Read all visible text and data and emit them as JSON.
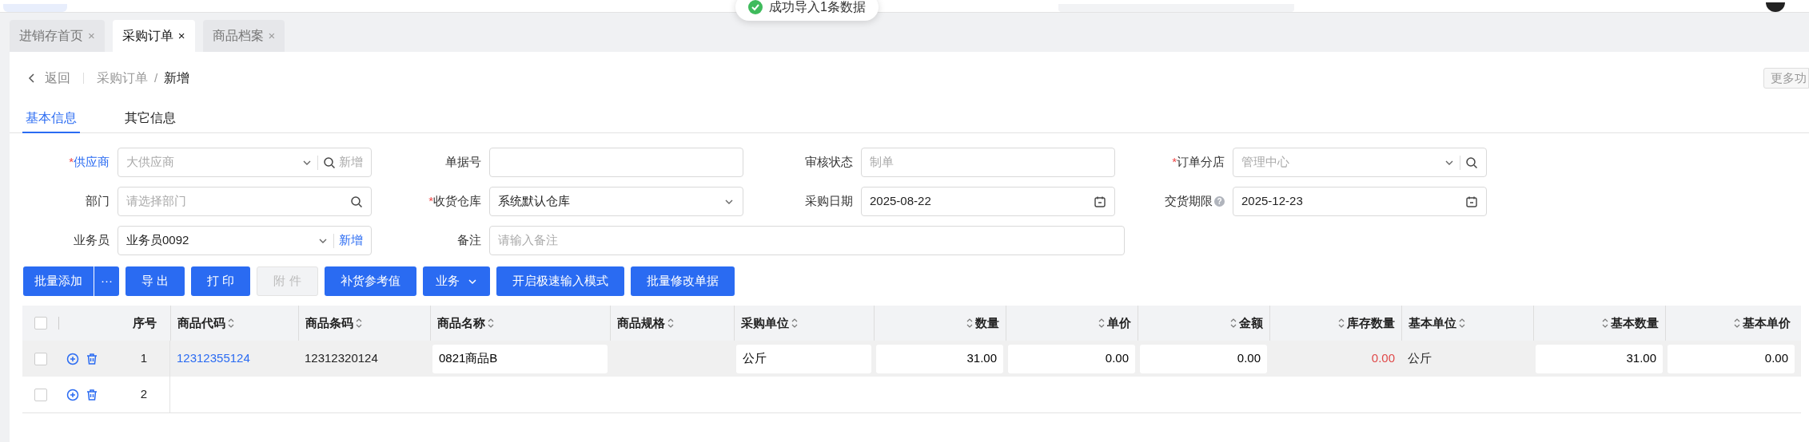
{
  "toast": {
    "text": "成功导入1条数据"
  },
  "tabs": [
    {
      "label": "进销存首页",
      "selected": false,
      "close": "×"
    },
    {
      "label": "采购订单",
      "selected": true,
      "close": "×"
    },
    {
      "label": "商品档案",
      "selected": false,
      "close": "×"
    }
  ],
  "breadcrumb": {
    "back": "返回",
    "parent": "采购订单",
    "separator": "/",
    "current": "新增"
  },
  "more_button": "更多功",
  "section_tabs": [
    {
      "label": "基本信息",
      "selected": true
    },
    {
      "label": "其它信息",
      "selected": false
    }
  ],
  "form": [
    {
      "label": "供应商",
      "required_mark": "*",
      "kind": "select-search-add",
      "placeholder": "大供应商",
      "add": "新增",
      "add_active": false,
      "label_blue": true
    },
    {
      "label": "单据号",
      "kind": "text"
    },
    {
      "label": "审核状态",
      "kind": "text",
      "placeholder": "制单"
    },
    {
      "label": "订单分店",
      "required_mark": "*",
      "kind": "select-search",
      "placeholder": "管理中心"
    },
    {
      "label": "部门",
      "kind": "search",
      "placeholder": "请选择部门"
    },
    {
      "label": "收货仓库",
      "required_mark": "*",
      "kind": "select",
      "value": "系统默认仓库"
    },
    {
      "label": "采购日期",
      "kind": "date",
      "value": "2025-08-22"
    },
    {
      "label": "交货期限",
      "kind": "date",
      "value": "2025-12-23",
      "help": "?"
    },
    {
      "label": "业务员",
      "kind": "select-add",
      "value": "业务员0092",
      "add": "新增",
      "add_active": true
    },
    {
      "label": "备注",
      "kind": "wide",
      "placeholder": "请输入备注"
    }
  ],
  "toolbar": [
    {
      "label": "批量添加",
      "kind": "split",
      "more": "···",
      "disabled": false
    },
    {
      "label": "导 出",
      "kind": "plain",
      "disabled": false
    },
    {
      "label": "打 印",
      "kind": "plain",
      "disabled": false
    },
    {
      "label": "附 件",
      "kind": "plain",
      "disabled": true
    },
    {
      "label": "补货参考值",
      "kind": "plain",
      "disabled": false
    },
    {
      "label": "业务",
      "kind": "dropdown",
      "disabled": false
    },
    {
      "label": "开启极速输入模式",
      "kind": "plain",
      "disabled": false
    },
    {
      "label": "批量修改单据",
      "kind": "plain",
      "disabled": false
    }
  ],
  "table": {
    "header_checked": false,
    "columns": [
      {
        "label": "序号",
        "sortable": false,
        "kind": "index"
      },
      {
        "label": "商品代码",
        "sortable": true,
        "kind": "text"
      },
      {
        "label": "商品条码",
        "sortable": true,
        "kind": "text"
      },
      {
        "label": "商品名称",
        "sortable": true,
        "kind": "text"
      },
      {
        "label": "商品规格",
        "sortable": true,
        "kind": "text"
      },
      {
        "label": "采购单位",
        "sortable": true,
        "kind": "text"
      },
      {
        "label": "数量",
        "sortable": true,
        "kind": "number"
      },
      {
        "label": "单价",
        "sortable": true,
        "kind": "number"
      },
      {
        "label": "金额",
        "sortable": true,
        "kind": "number"
      },
      {
        "label": "库存数量",
        "sortable": true,
        "kind": "number"
      },
      {
        "label": "基本单位",
        "sortable": true,
        "kind": "text"
      },
      {
        "label": "基本数量",
        "sortable": true,
        "kind": "number"
      },
      {
        "label": "基本单价",
        "sortable": true,
        "kind": "number"
      }
    ],
    "rows": [
      {
        "checked": false,
        "cells": [
          {
            "kind": "text",
            "value": "1"
          },
          {
            "kind": "link",
            "value": "12312355124"
          },
          {
            "kind": "text",
            "value": "12312320124"
          },
          {
            "kind": "input",
            "value": "0821商品B"
          },
          {
            "kind": "empty"
          },
          {
            "kind": "input",
            "value": "公斤"
          },
          {
            "kind": "input",
            "value": "31.00"
          },
          {
            "kind": "input",
            "value": "0.00"
          },
          {
            "kind": "input",
            "value": "0.00"
          },
          {
            "kind": "warn",
            "value": "0.00"
          },
          {
            "kind": "text",
            "value": "公斤"
          },
          {
            "kind": "input",
            "value": "31.00"
          },
          {
            "kind": "input",
            "value": "0.00"
          }
        ]
      },
      {
        "checked": false,
        "cells": [
          {
            "kind": "text",
            "value": "2"
          }
        ]
      }
    ]
  }
}
